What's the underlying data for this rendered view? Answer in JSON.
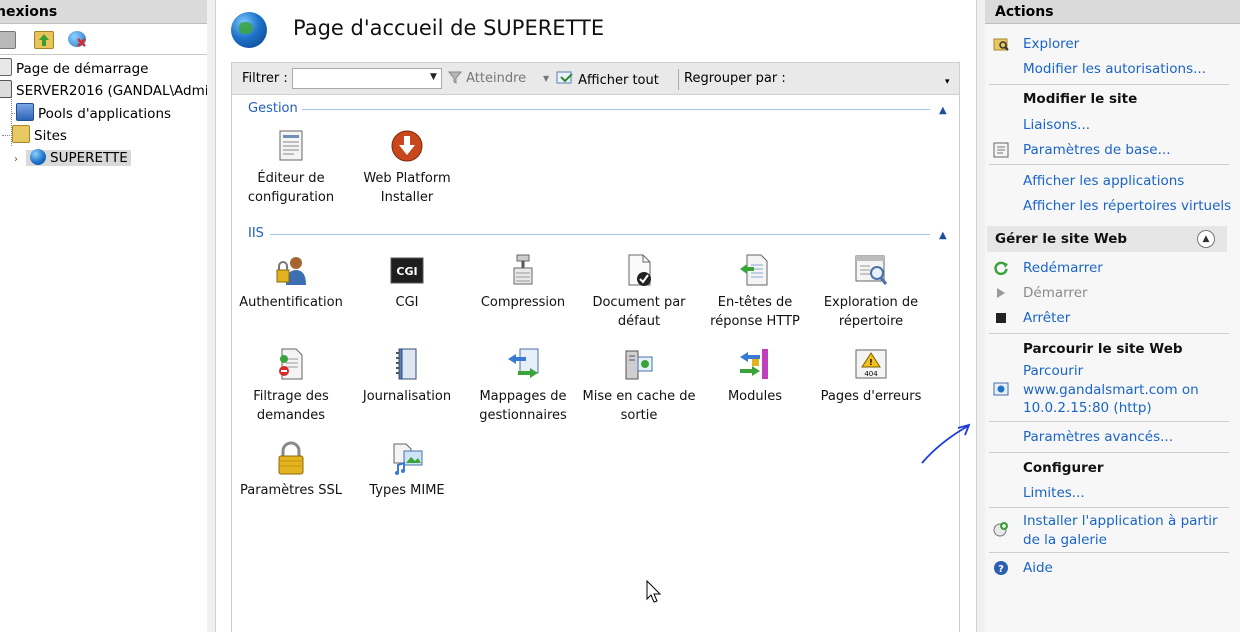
{
  "connections": {
    "header": "nexions",
    "tree": {
      "start_page": "Page de démarrage",
      "server": "SERVER2016 (GANDAL\\Admin",
      "app_pools": "Pools d'applications",
      "sites": "Sites",
      "site": "SUPERETTE"
    }
  },
  "main": {
    "title": "Page d'accueil de SUPERETTE",
    "filter_label": "Filtrer :",
    "filter_value": "",
    "goto_label": "Atteindre",
    "show_all_label": "Afficher tout",
    "group_by_label": "Regrouper par :",
    "sections": [
      {
        "label": "Gestion",
        "features": [
          {
            "label": "Éditeur de configuration",
            "icon": "config-editor-icon"
          },
          {
            "label": "Web Platform Installer",
            "icon": "web-platform-installer-icon"
          }
        ]
      },
      {
        "label": "IIS",
        "features": [
          {
            "label": "Authentification",
            "icon": "authentication-icon"
          },
          {
            "label": "CGI",
            "icon": "cgi-icon"
          },
          {
            "label": "Compression",
            "icon": "compression-icon"
          },
          {
            "label": "Document par défaut",
            "icon": "default-document-icon"
          },
          {
            "label": "En-têtes de réponse HTTP",
            "icon": "http-headers-icon"
          },
          {
            "label": "Exploration de répertoire",
            "icon": "directory-browsing-icon"
          },
          {
            "label": "Filtrage des demandes",
            "icon": "request-filtering-icon"
          },
          {
            "label": "Journalisation",
            "icon": "logging-icon"
          },
          {
            "label": "Mappages de gestionnaires",
            "icon": "handler-mappings-icon"
          },
          {
            "label": "Mise en cache de sortie",
            "icon": "output-caching-icon"
          },
          {
            "label": "Modules",
            "icon": "modules-icon"
          },
          {
            "label": "Pages d'erreurs",
            "icon": "error-pages-icon"
          },
          {
            "label": "Paramètres SSL",
            "icon": "ssl-settings-icon"
          },
          {
            "label": "Types MIME",
            "icon": "mime-types-icon"
          }
        ]
      }
    ]
  },
  "actions": {
    "header": "Actions",
    "explore": "Explorer",
    "edit_permissions": "Modifier les autorisations...",
    "edit_site_head": "Modifier le site",
    "bindings": "Liaisons...",
    "basic_settings": "Paramètres de base...",
    "view_apps": "Afficher les applications",
    "view_vdirs": "Afficher les répertoires virtuels",
    "manage_head": "Gérer le site Web",
    "restart": "Redémarrer",
    "start": "Démarrer",
    "stop": "Arrêter",
    "browse_head": "Parcourir le site Web",
    "browse_line1": "Parcourir",
    "browse_line2": "www.gandalsmart.com on",
    "browse_line3": "10.0.2.15:80 (http)",
    "advanced_settings": "Paramètres avancés...",
    "configure_head": "Configurer",
    "limits": "Limites...",
    "install_line1": "Installer l'application à partir",
    "install_line2": "de la galerie",
    "help": "Aide"
  },
  "colors": {
    "link": "#1a64c9",
    "section": "#1f5fbf",
    "header_bg": "#dadada"
  }
}
